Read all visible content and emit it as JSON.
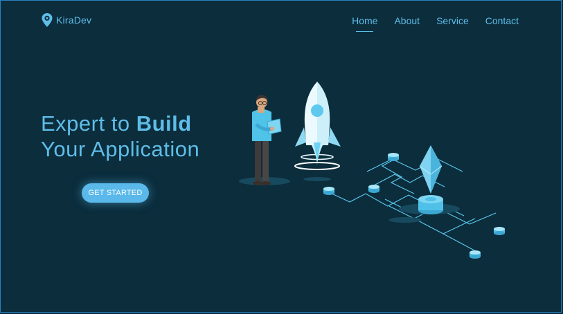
{
  "brand": {
    "name": "KiraDev",
    "icon": "map-pin-icon"
  },
  "nav": {
    "items": [
      {
        "label": "Home",
        "active": true
      },
      {
        "label": "About",
        "active": false
      },
      {
        "label": "Service",
        "active": false
      },
      {
        "label": "Contact",
        "active": false
      }
    ]
  },
  "hero": {
    "line1_light": "Expert to ",
    "line1_strong": "Build",
    "line2": "Your Application",
    "cta_label": "GET STARTED"
  },
  "colors": {
    "background": "#0b2d3c",
    "accent": "#5fbde8",
    "button": "#5ab8ea"
  }
}
